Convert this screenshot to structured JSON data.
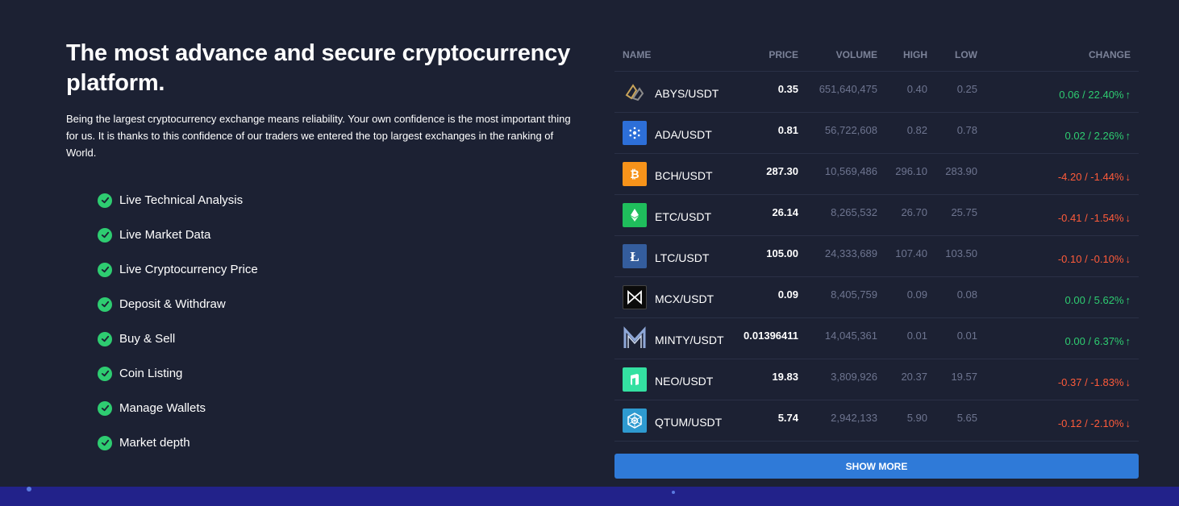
{
  "hero": {
    "headline": "The most advance and secure cryptocurrency platform.",
    "description": "Being the largest cryptocurrency exchange means reliability. Your own confidence is the most important thing for us. It is thanks to this confidence of our traders we entered the top largest exchanges in the ranking of World.",
    "features": [
      "Live Technical Analysis",
      "Live Market Data",
      "Live Cryptocurrency Price",
      "Deposit & Withdraw",
      "Buy & Sell",
      "Coin Listing",
      "Manage Wallets",
      "Market depth"
    ]
  },
  "market": {
    "columns": {
      "name": "NAME",
      "price": "PRICE",
      "volume": "VOLUME",
      "high": "HIGH",
      "low": "LOW",
      "change": "CHANGE"
    },
    "rows": [
      {
        "pair": "ABYS/USDT",
        "price": "0.35",
        "volume": "651,640,475",
        "high": "0.40",
        "low": "0.25",
        "change": "0.06 / 22.40%",
        "direction": "up",
        "icon": "abys-icon"
      },
      {
        "pair": "ADA/USDT",
        "price": "0.81",
        "volume": "56,722,608",
        "high": "0.82",
        "low": "0.78",
        "change": "0.02 / 2.26%",
        "direction": "up",
        "icon": "ada-icon"
      },
      {
        "pair": "BCH/USDT",
        "price": "287.30",
        "volume": "10,569,486",
        "high": "296.10",
        "low": "283.90",
        "change": "-4.20 / -1.44%",
        "direction": "down",
        "icon": "bch-icon"
      },
      {
        "pair": "ETC/USDT",
        "price": "26.14",
        "volume": "8,265,532",
        "high": "26.70",
        "low": "25.75",
        "change": "-0.41 / -1.54%",
        "direction": "down",
        "icon": "etc-icon"
      },
      {
        "pair": "LTC/USDT",
        "price": "105.00",
        "volume": "24,333,689",
        "high": "107.40",
        "low": "103.50",
        "change": "-0.10 / -0.10%",
        "direction": "down",
        "icon": "ltc-icon"
      },
      {
        "pair": "MCX/USDT",
        "price": "0.09",
        "volume": "8,405,759",
        "high": "0.09",
        "low": "0.08",
        "change": "0.00 / 5.62%",
        "direction": "up",
        "icon": "mcx-icon"
      },
      {
        "pair": "MINTY/USDT",
        "price": "0.01396411",
        "volume": "14,045,361",
        "high": "0.01",
        "low": "0.01",
        "change": "0.00 / 6.37%",
        "direction": "up",
        "icon": "minty-icon"
      },
      {
        "pair": "NEO/USDT",
        "price": "19.83",
        "volume": "3,809,926",
        "high": "20.37",
        "low": "19.57",
        "change": "-0.37 / -1.83%",
        "direction": "down",
        "icon": "neo-icon"
      },
      {
        "pair": "QTUM/USDT",
        "price": "5.74",
        "volume": "2,942,133",
        "high": "5.90",
        "low": "5.65",
        "change": "-0.12 / -2.10%",
        "direction": "down",
        "icon": "qtum-icon"
      }
    ],
    "show_more_label": "SHOW MORE"
  },
  "colors": {
    "background": "#1c2133",
    "positive": "#2ecc71",
    "negative": "#ff5b3a",
    "button": "#2f7ad8",
    "footer_band": "#22228a"
  }
}
